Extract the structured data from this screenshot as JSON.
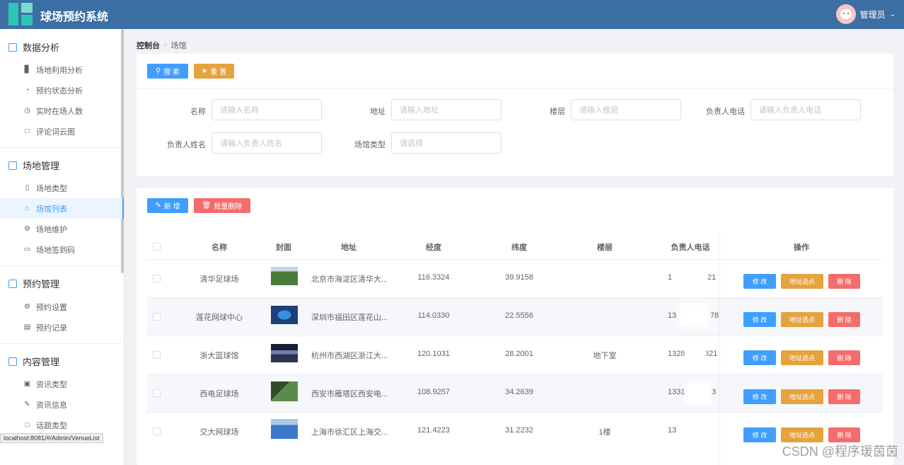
{
  "header": {
    "app_title": "球场预约系统",
    "user_name": "管理员"
  },
  "sidebar": {
    "groups": [
      {
        "title": "数据分析",
        "items": [
          {
            "label": "场地利用分析",
            "icon": "bar-chart-icon"
          },
          {
            "label": "预约状态分析",
            "icon": "pie-chart-icon"
          },
          {
            "label": "实时在场人数",
            "icon": "clock-icon"
          },
          {
            "label": "评论词云图",
            "icon": "message-icon"
          }
        ]
      },
      {
        "title": "场地管理",
        "items": [
          {
            "label": "场地类型",
            "icon": "bookmark-icon"
          },
          {
            "label": "场馆列表",
            "icon": "home-icon"
          },
          {
            "label": "场地维护",
            "icon": "gear-icon"
          },
          {
            "label": "场地签到码",
            "icon": "monitor-icon"
          }
        ]
      },
      {
        "title": "预约管理",
        "items": [
          {
            "label": "预约设置",
            "icon": "gear-icon"
          },
          {
            "label": "预约记录",
            "icon": "document-icon"
          }
        ]
      },
      {
        "title": "内容管理",
        "items": [
          {
            "label": "资讯类型",
            "icon": "save-icon"
          },
          {
            "label": "资讯信息",
            "icon": "edit-icon"
          },
          {
            "label": "话题类型",
            "icon": "message-icon"
          }
        ]
      }
    ],
    "active_item": "场馆列表"
  },
  "status_url": "localhost:8081/#/Admin/VenueList",
  "breadcrumb": {
    "home": "控制台",
    "current": "场馆"
  },
  "search": {
    "search_button": "搜 索",
    "reset_button": "重 置",
    "fields": [
      {
        "label": "名称",
        "placeholder": "请输入名称"
      },
      {
        "label": "地址",
        "placeholder": "请输入地址"
      },
      {
        "label": "楼层",
        "placeholder": "请输入楼层"
      },
      {
        "label": "负责人电话",
        "placeholder": "请输入负责人电话"
      },
      {
        "label": "负责人姓名",
        "placeholder": "请输入负责人姓名"
      },
      {
        "label": "场馆类型",
        "placeholder": "请选择"
      }
    ]
  },
  "table": {
    "add_button": "新 增",
    "batch_delete_button": "批量删除",
    "columns": [
      "名称",
      "封面",
      "地址",
      "经度",
      "纬度",
      "楼层",
      "负责人电话",
      "操作"
    ],
    "row_actions": {
      "edit": "修 改",
      "location": "地址选点",
      "delete": "删 除"
    },
    "rows": [
      {
        "name": "清华足球场",
        "address": "北京市海淀区清华大...",
        "lng": "116.3324",
        "lat": "39.9158",
        "floor": "",
        "phone_start": "1",
        "phone_end": "21",
        "cover_color": "#4a7a3a"
      },
      {
        "name": "莲花网球中心",
        "address": "深圳市福田区莲花山...",
        "lng": "114.0330",
        "lat": "22.5556",
        "floor": "",
        "phone_start": "13",
        "phone_end": "78",
        "cover_color": "#2a5fa8"
      },
      {
        "name": "浙大篮球馆",
        "address": "杭州市西湖区浙江大...",
        "lng": "120.1031",
        "lat": "28.2001",
        "floor": "地下室",
        "phone_start": "1328",
        "phone_end": "321",
        "cover_color": "#2b3550"
      },
      {
        "name": "西电足球场",
        "address": "西安市雁塔区西安电...",
        "lng": "108.9257",
        "lat": "34.2639",
        "floor": "",
        "phone_start": "1331",
        "phone_end": "3",
        "cover_color": "#3e6b38"
      },
      {
        "name": "交大网球场",
        "address": "上海市徐汇区上海交...",
        "lng": "121.4223",
        "lat": "31.2232",
        "floor": "1楼",
        "phone_start": "13",
        "phone_end": "",
        "cover_color": "#3a79c8"
      }
    ]
  },
  "watermark": "CSDN @程序瑗茵茵",
  "colors": {
    "header": "#3c6fa3",
    "primary": "#409eff",
    "warning": "#e6a23c",
    "danger": "#f56c6c"
  }
}
